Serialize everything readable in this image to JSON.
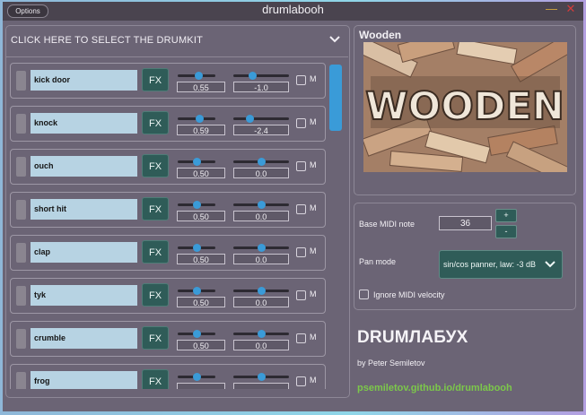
{
  "window": {
    "title": "drumlabooh",
    "options_label": "Options",
    "minimize_glyph": "—",
    "close_glyph": "✕"
  },
  "drumkit_selector": {
    "label": "CLICK HERE TO SELECT THE DRUMKIT"
  },
  "kit": {
    "name": "Wooden",
    "image_text": "WOODEN"
  },
  "rows": [
    {
      "name": "kick door",
      "fx": "FX",
      "gain": "0.55",
      "pan": "-1.0",
      "gain_level": 0.55,
      "pan_level": 0.35,
      "mute": "M"
    },
    {
      "name": "knock",
      "fx": "FX",
      "gain": "0.59",
      "pan": "-2.4",
      "gain_level": 0.59,
      "pan_level": 0.3,
      "mute": "M"
    },
    {
      "name": "ouch",
      "fx": "FX",
      "gain": "0.50",
      "pan": "0.0",
      "gain_level": 0.5,
      "pan_level": 0.5,
      "mute": "M"
    },
    {
      "name": "short hit",
      "fx": "FX",
      "gain": "0.50",
      "pan": "0.0",
      "gain_level": 0.5,
      "pan_level": 0.5,
      "mute": "M"
    },
    {
      "name": "clap",
      "fx": "FX",
      "gain": "0.50",
      "pan": "0.0",
      "gain_level": 0.5,
      "pan_level": 0.5,
      "mute": "M"
    },
    {
      "name": "tyk",
      "fx": "FX",
      "gain": "0.50",
      "pan": "0.0",
      "gain_level": 0.5,
      "pan_level": 0.5,
      "mute": "M"
    },
    {
      "name": "crumble",
      "fx": "FX",
      "gain": "0.50",
      "pan": "0.0",
      "gain_level": 0.5,
      "pan_level": 0.5,
      "mute": "M"
    },
    {
      "name": "frog",
      "fx": "FX",
      "gain": "",
      "pan": "",
      "gain_level": 0.5,
      "pan_level": 0.5,
      "mute": "M"
    }
  ],
  "settings": {
    "base_midi_label": "Base MIDI note",
    "base_midi_value": "36",
    "plus": "+",
    "minus": "-",
    "pan_mode_label": "Pan mode",
    "pan_mode_value": "sin/cos panner, law: -3 dB",
    "ignore_velocity_label": "Ignore MIDI velocity"
  },
  "brand": {
    "name": "DRUMЛАБУХ",
    "author": "by Peter Semiletov",
    "link": "psemiletov.github.io/drumlabooh"
  },
  "colors": {
    "accent": "#3a9bd8",
    "fx_button": "#2f5c58",
    "link": "#7cc84a",
    "name_field": "#b7d3e3"
  }
}
